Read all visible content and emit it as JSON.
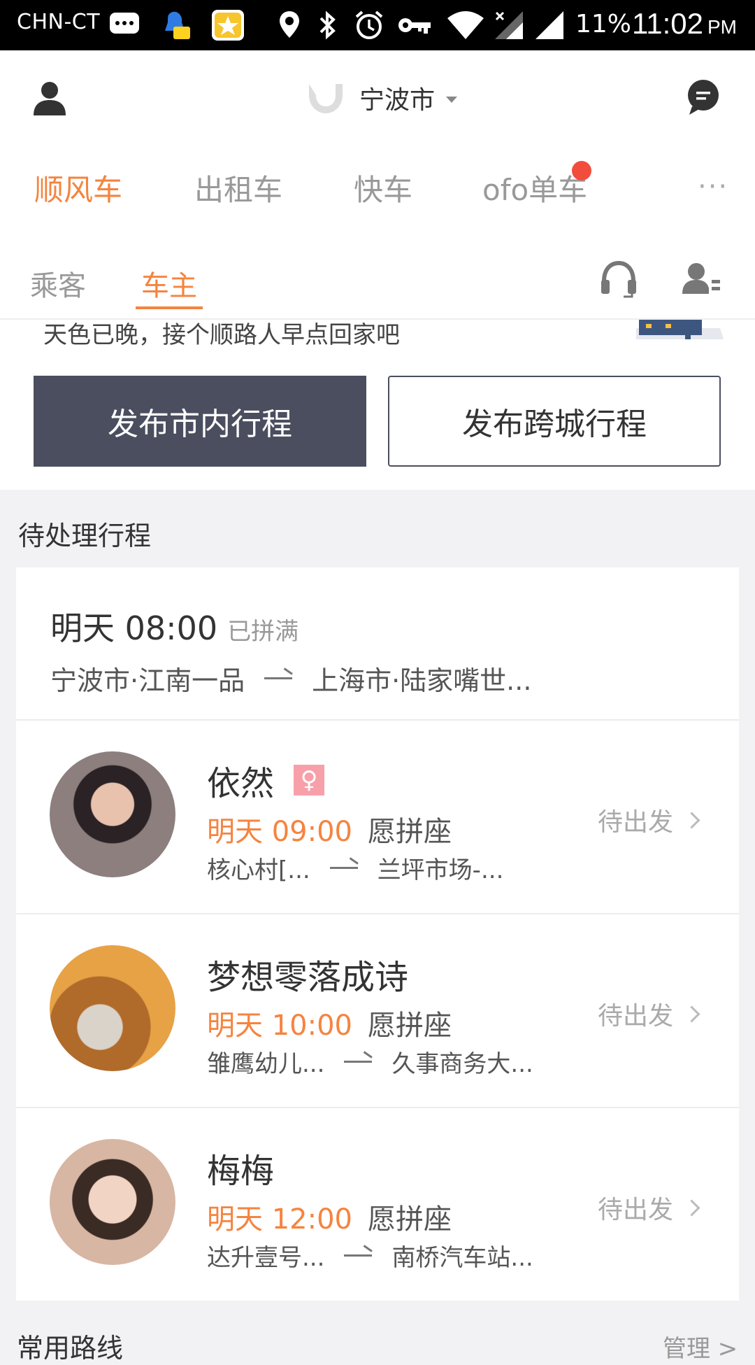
{
  "status_bar": {
    "carrier": "CHN-CT",
    "battery": "11%",
    "time": "11:02",
    "ampm": "PM"
  },
  "header": {
    "city": "宁波市",
    "tabs": [
      {
        "label": "顺风车",
        "active": true
      },
      {
        "label": "出租车",
        "active": false
      },
      {
        "label": "快车",
        "active": false
      },
      {
        "label": "ofo单车",
        "active": false,
        "hot_badge": true
      }
    ],
    "more": "···"
  },
  "subtabs": [
    {
      "label": "乘客",
      "active": false
    },
    {
      "label": "车主",
      "active": true
    }
  ],
  "banner": {
    "tagline": "天色已晚，接个顺路人早点回家吧",
    "publish_city_trip": "发布市内行程",
    "publish_intercity_trip": "发布跨城行程"
  },
  "pending": {
    "section_title": "待处理行程",
    "trip": {
      "time": "明天 08:00",
      "status": "已拼满",
      "from": "宁波市·江南一品",
      "to": "上海市·陆家嘴世..."
    },
    "passengers": [
      {
        "name": "依然",
        "gender": "♀",
        "time": "明天 09:00",
        "seat": "愿拼座",
        "from": "核心村[...",
        "to": "兰坪市场-...",
        "state": "待出发"
      },
      {
        "name": "梦想零落成诗",
        "gender": "",
        "time": "明天 10:00",
        "seat": "愿拼座",
        "from": "雏鹰幼儿...",
        "to": "久事商务大...",
        "state": "待出发"
      },
      {
        "name": "梅梅",
        "gender": "",
        "time": "明天 12:00",
        "seat": "愿拼座",
        "from": "达升壹号...",
        "to": "南桥汽车站...",
        "state": "待出发"
      }
    ]
  },
  "footer": {
    "title": "常用路线",
    "manage": "管理 >"
  },
  "colors": {
    "accent": "#f5843f",
    "primary_button": "#4b4e5e",
    "background": "#f2f2f4"
  }
}
